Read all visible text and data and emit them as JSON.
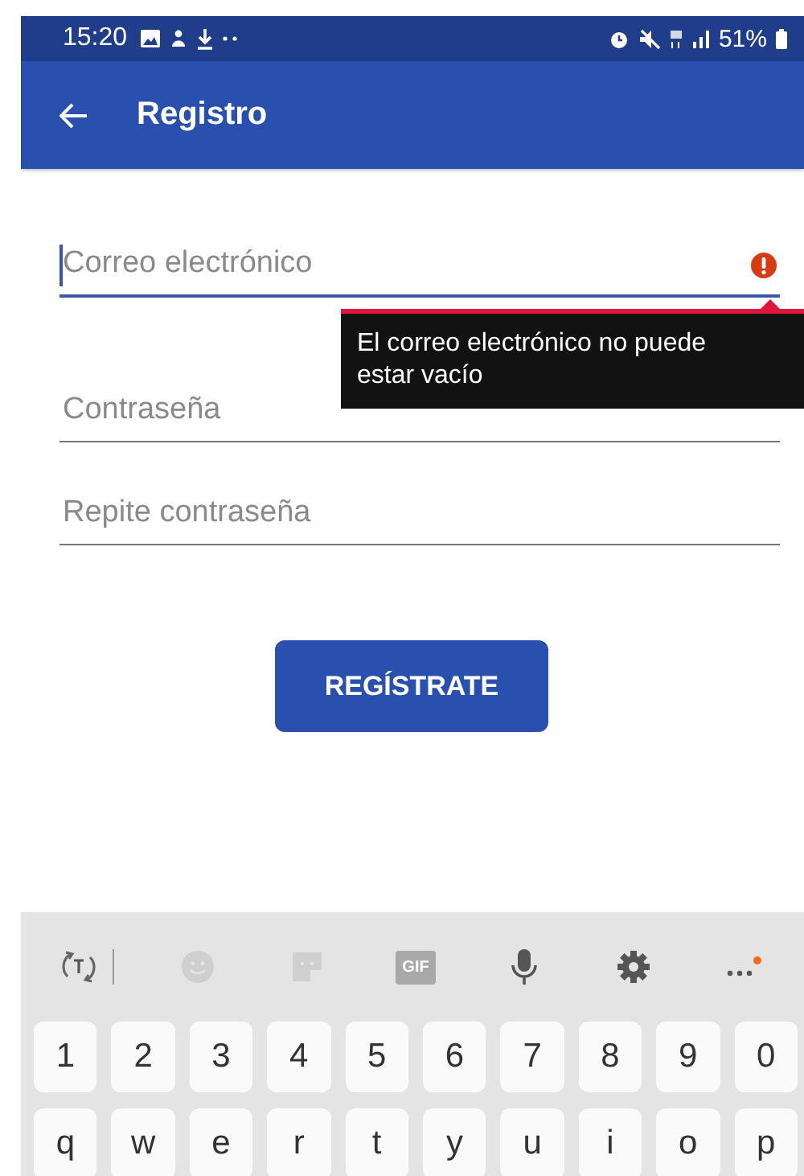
{
  "status_bar": {
    "time": "15:20",
    "battery": "51%"
  },
  "app_bar": {
    "title": "Registro"
  },
  "fields": [
    {
      "placeholder": "Correo electrónico",
      "focused": true,
      "error": "El correo electrónico no puede estar vacío"
    },
    {
      "placeholder": "Contraseña",
      "focused": false
    },
    {
      "placeholder": "Repite contraseña",
      "focused": false
    }
  ],
  "submit_button": "REGÍSTRATE",
  "keyboard": {
    "toolbar": [
      {
        "kind": "translate"
      },
      {
        "kind": "emoji"
      },
      {
        "kind": "sticker"
      },
      {
        "kind": "gif",
        "label": "GIF"
      },
      {
        "kind": "mic"
      },
      {
        "kind": "settings"
      },
      {
        "kind": "more"
      }
    ],
    "rows": [
      [
        "1",
        "2",
        "3",
        "4",
        "5",
        "6",
        "7",
        "8",
        "9",
        "0"
      ],
      [
        "q",
        "w",
        "e",
        "r",
        "t",
        "y",
        "u",
        "i",
        "o",
        "p"
      ]
    ]
  }
}
